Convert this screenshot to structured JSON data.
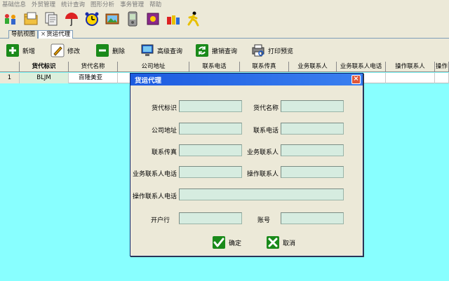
{
  "menu": [
    "基础信息",
    "外贸管理",
    "统计查询",
    "图形分析",
    "事务管理",
    "帮助"
  ],
  "tabs": [
    "导航视图",
    "货运代理"
  ],
  "tab_close": "×",
  "toolbar": {
    "add": "新增",
    "edit": "修改",
    "delete": "删除",
    "advanced_query": "高级查询",
    "cancel_query": "撤销查询",
    "print_preview": "打印预览"
  },
  "grid": {
    "columns": [
      "货代标识",
      "货代名称",
      "公司地址",
      "联系电话",
      "联系传真",
      "业务联系人",
      "业务联系人电话",
      "操作联系人",
      "操作"
    ],
    "rows": [
      {
        "num": "1",
        "cells": [
          "BLJM",
          "百隆美亚",
          "",
          "",
          "",
          "",
          "",
          "",
          ""
        ]
      }
    ]
  },
  "dialog": {
    "title": "货运代理",
    "close": "×",
    "fields": {
      "agent_id": "货代标识",
      "agent_name": "货代名称",
      "address": "公司地址",
      "phone": "联系电话",
      "fax": "联系传真",
      "biz_contact": "业务联系人",
      "biz_contact_phone": "业务联系人电话",
      "op_contact": "操作联系人",
      "op_contact_phone": "操作联系人电话",
      "bank": "开户行",
      "account": "账号"
    },
    "values": {
      "agent_id": "",
      "agent_name": "",
      "address": "",
      "phone": "",
      "fax": "",
      "biz_contact": "",
      "biz_contact_phone": "",
      "op_contact": "",
      "op_contact_phone": "",
      "bank": "",
      "account": ""
    },
    "ok": "确定",
    "cancel": "取消"
  },
  "colors": {
    "grid_bg": "#88ffff",
    "title_bar": "#2a6ee8",
    "input_bg": "#d6ece0"
  }
}
